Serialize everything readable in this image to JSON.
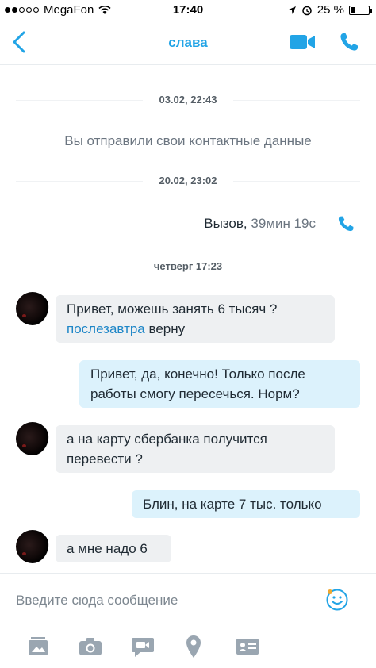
{
  "status_bar": {
    "carrier": "MegaFon",
    "signal_bars_filled": 2,
    "signal_bars_total": 5,
    "time": "17:40",
    "battery": "25 %",
    "battery_level": 0.25
  },
  "nav": {
    "title": "слава",
    "back_icon": "chevron-left-icon",
    "video_icon": "video-camera-icon",
    "call_icon": "phone-icon",
    "accent_color": "#22a4e6"
  },
  "chat": {
    "date_1": "03.02, 22:43",
    "system_message": "Вы отправили свои контактные данные",
    "date_2": "20.02, 23:02",
    "call": {
      "label": "Вызов,",
      "duration": "39мин 19с"
    },
    "date_3": "четверг 17:23",
    "messages": [
      {
        "direction": "in",
        "line1": "Привет, можешь занять 6 тысяч ?",
        "line2_link": "послезавтра",
        "line2_rest": " верну"
      },
      {
        "direction": "out",
        "line1": "Привет, да, конечно! Только после",
        "line2": "работы смогу пересечься. Норм?"
      },
      {
        "direction": "in",
        "line1": "а на карту сбербанка получится",
        "line2": "перевести ?"
      },
      {
        "direction": "out",
        "text": "Блин, на карте 7 тыс. только"
      },
      {
        "direction": "in",
        "text": "а мне надо 6"
      }
    ]
  },
  "composer": {
    "placeholder": "Введите сюда сообщение",
    "emoji_icon": "smiley-icon",
    "toolbar_icons": [
      "photo-gallery-icon",
      "camera-icon",
      "video-message-icon",
      "location-icon",
      "contact-card-icon"
    ]
  },
  "colors": {
    "incoming_bubble": "#eef0f2",
    "outgoing_bubble": "#dcf2fc",
    "link": "#1e86c7",
    "icon_gray": "#9aa6b1"
  }
}
